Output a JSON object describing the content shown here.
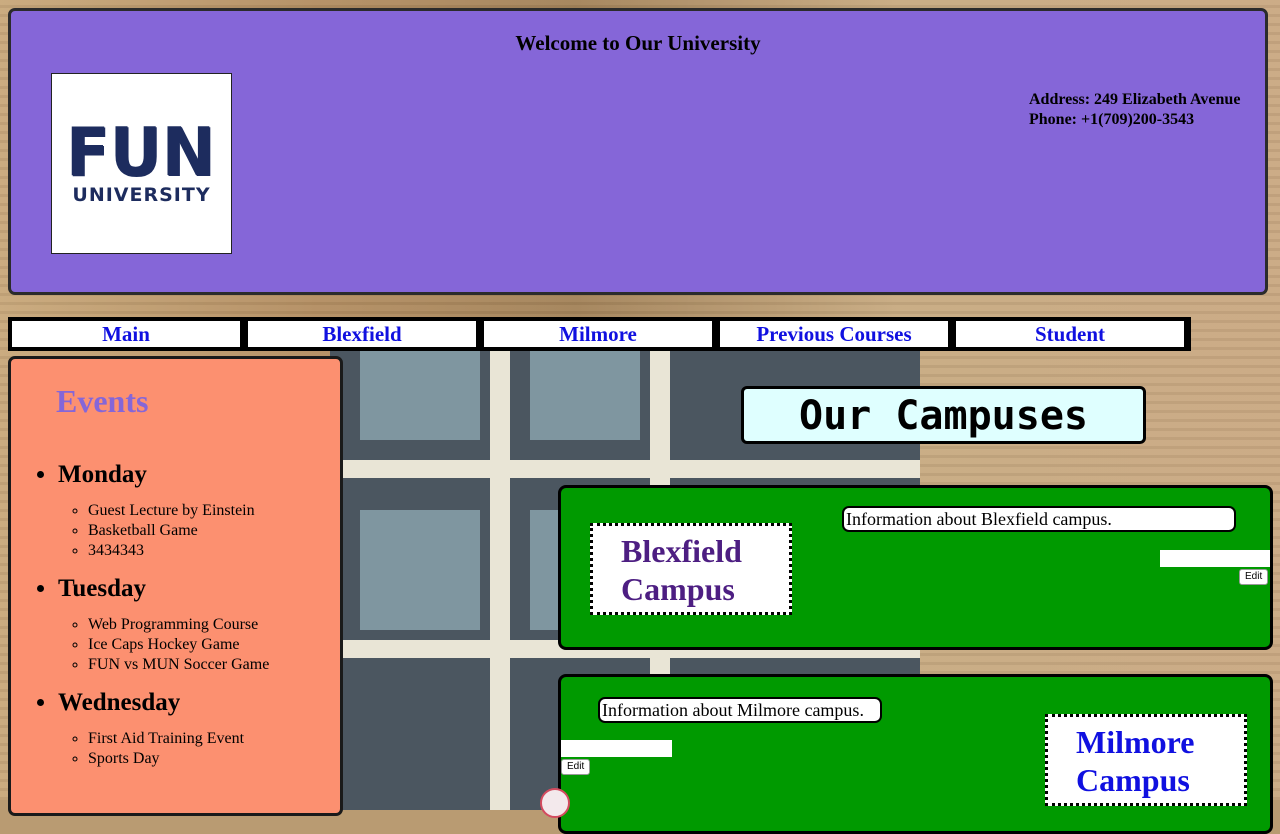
{
  "header": {
    "title": "Welcome to Our University",
    "logo_line1": "FUN",
    "logo_line2": "UNIVERSITY",
    "address": "Address: 249 Elizabeth Avenue",
    "phone": "Phone: +1(709)200-3543"
  },
  "nav": [
    "Main",
    "Blexfield",
    "Milmore",
    "Previous Courses",
    "Student"
  ],
  "events": {
    "heading": "Events",
    "days": [
      {
        "name": "Monday",
        "items": [
          "Guest Lecture by Einstein",
          "Basketball Game",
          "3434343"
        ]
      },
      {
        "name": "Tuesday",
        "items": [
          "Web Programming Course",
          "Ice Caps Hockey Game",
          "FUN vs MUN Soccer Game"
        ]
      },
      {
        "name": "Wednesday",
        "items": [
          "First Aid Training Event",
          "Sports Day"
        ]
      }
    ]
  },
  "campuses": {
    "heading": "Our Campuses",
    "blexfield": {
      "name_line1": "Blexfield",
      "name_line2": "Campus",
      "info": "Information about Blexfield campus.",
      "edit_value": "",
      "edit_label": "Edit"
    },
    "milmore": {
      "name_line1": "Milmore",
      "name_line2": "Campus",
      "info": "Information about Milmore campus.",
      "edit_value": "",
      "edit_label": "Edit"
    }
  },
  "colors": {
    "header_bg": "#8566d8",
    "events_bg": "#fc9070",
    "campus_bg": "#009a00",
    "nav_link": "#1010e0"
  }
}
